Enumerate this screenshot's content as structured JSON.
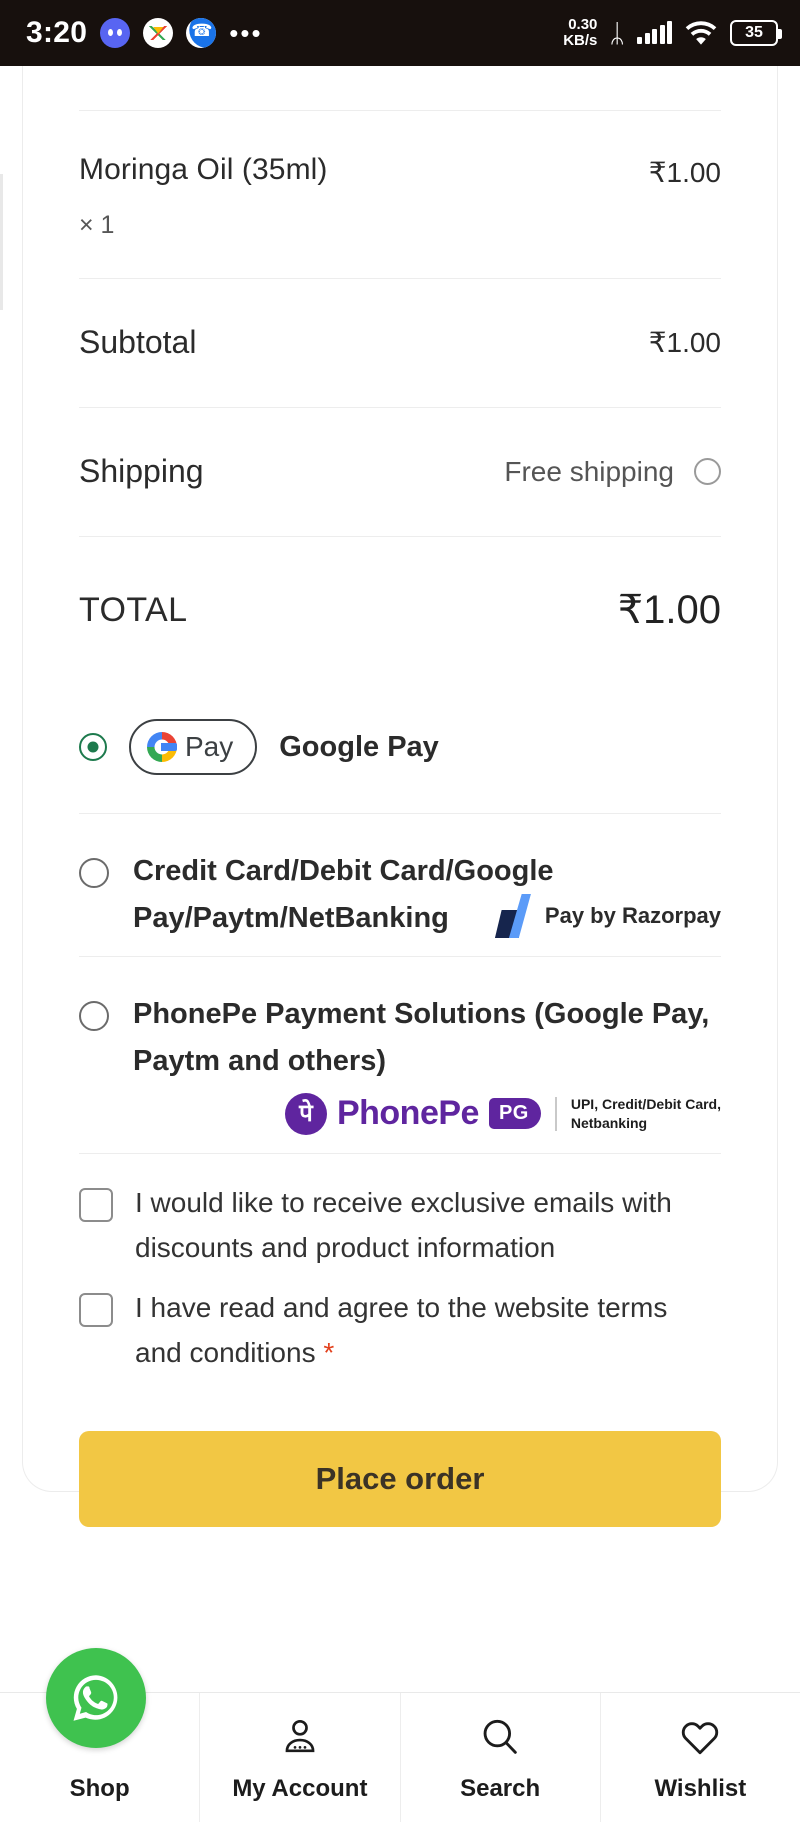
{
  "statusbar": {
    "time": "3:20",
    "icons": [
      "discord-icon",
      "gmail-icon",
      "phone-icon"
    ],
    "overflow": "•••",
    "network_speed": "0.30",
    "network_unit": "KB/s",
    "bluetooth": "ᛦ",
    "battery_percent": "35"
  },
  "order": {
    "item": {
      "name": "Moringa Oil (35ml)",
      "quantity": "× 1",
      "price": "₹1.00"
    },
    "subtotal_label": "Subtotal",
    "subtotal_value": "₹1.00",
    "shipping_label": "Shipping",
    "shipping_option": "Free shipping",
    "total_label": "TOTAL",
    "total_value": "₹1.00"
  },
  "payment_methods": {
    "gpay": {
      "badge_text": "Pay",
      "label": "Google Pay",
      "selected": true
    },
    "razorpay": {
      "label": "Credit Card/Debit Card/Google Pay/Paytm/NetBanking",
      "brand_text": "Pay by Razorpay",
      "selected": false
    },
    "phonepe": {
      "label": "PhonePe Payment Solutions (Google Pay, Paytm and others)",
      "brand_word": "PhonePe",
      "brand_glyph": "पे",
      "brand_badge": "PG",
      "brand_sub_line1": "UPI, Credit/Debit Card,",
      "brand_sub_line2": "Netbanking",
      "selected": false
    }
  },
  "consents": [
    {
      "text": "I would like to receive exclusive emails with discounts and product information",
      "checked": false,
      "required_mark": ""
    },
    {
      "text": "I have read and agree to the website terms and conditions ",
      "checked": false,
      "required_mark": "*"
    }
  ],
  "place_order_label": "Place order",
  "bottom_nav": {
    "items": [
      {
        "label": "Shop",
        "icon": "whatsapp-icon"
      },
      {
        "label": "My Account",
        "icon": "person-icon"
      },
      {
        "label": "Search",
        "icon": "search-icon"
      },
      {
        "label": "Wishlist",
        "icon": "heart-icon"
      }
    ]
  },
  "colors": {
    "accent_button": "#f2c744",
    "selected_radio": "#1d7a4d",
    "required": "#e2401c",
    "phonepe_purple": "#5f259f",
    "whatsapp_green": "#3fc24f"
  }
}
